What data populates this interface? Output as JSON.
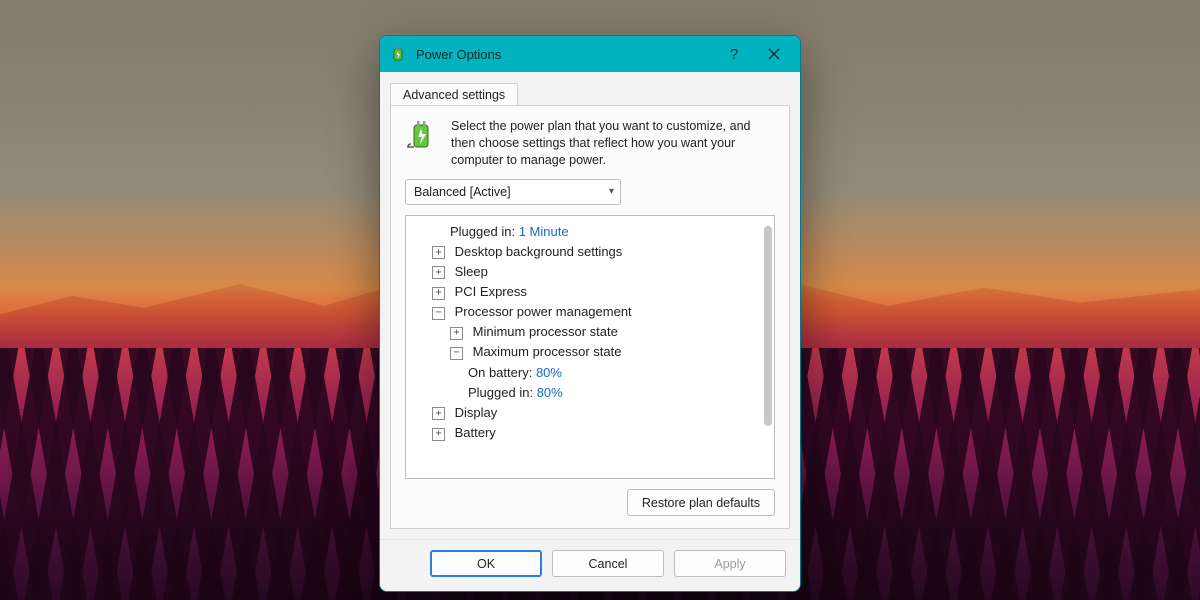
{
  "window": {
    "title": "Power Options",
    "help_tooltip": "?",
    "close_tooltip": "Close"
  },
  "tab": {
    "label": "Advanced settings"
  },
  "intro": {
    "text": "Select the power plan that you want to customize, and then choose settings that reflect how you want your computer to manage power."
  },
  "plan_selector": {
    "selected": "Balanced [Active]"
  },
  "tree": {
    "plugged_in_top": {
      "label": "Plugged in:",
      "value": "1 Minute"
    },
    "desktop_bg": {
      "label": "Desktop background settings"
    },
    "sleep": {
      "label": "Sleep"
    },
    "pci": {
      "label": "PCI Express"
    },
    "ppm": {
      "label": "Processor power management"
    },
    "min_ps": {
      "label": "Minimum processor state"
    },
    "max_ps": {
      "label": "Maximum processor state"
    },
    "on_battery": {
      "label": "On battery:",
      "value": "80%"
    },
    "plugged_in": {
      "label": "Plugged in:",
      "value": "80%"
    },
    "display": {
      "label": "Display"
    },
    "battery": {
      "label": "Battery"
    }
  },
  "buttons": {
    "restore": "Restore plan defaults",
    "ok": "OK",
    "cancel": "Cancel",
    "apply": "Apply"
  }
}
